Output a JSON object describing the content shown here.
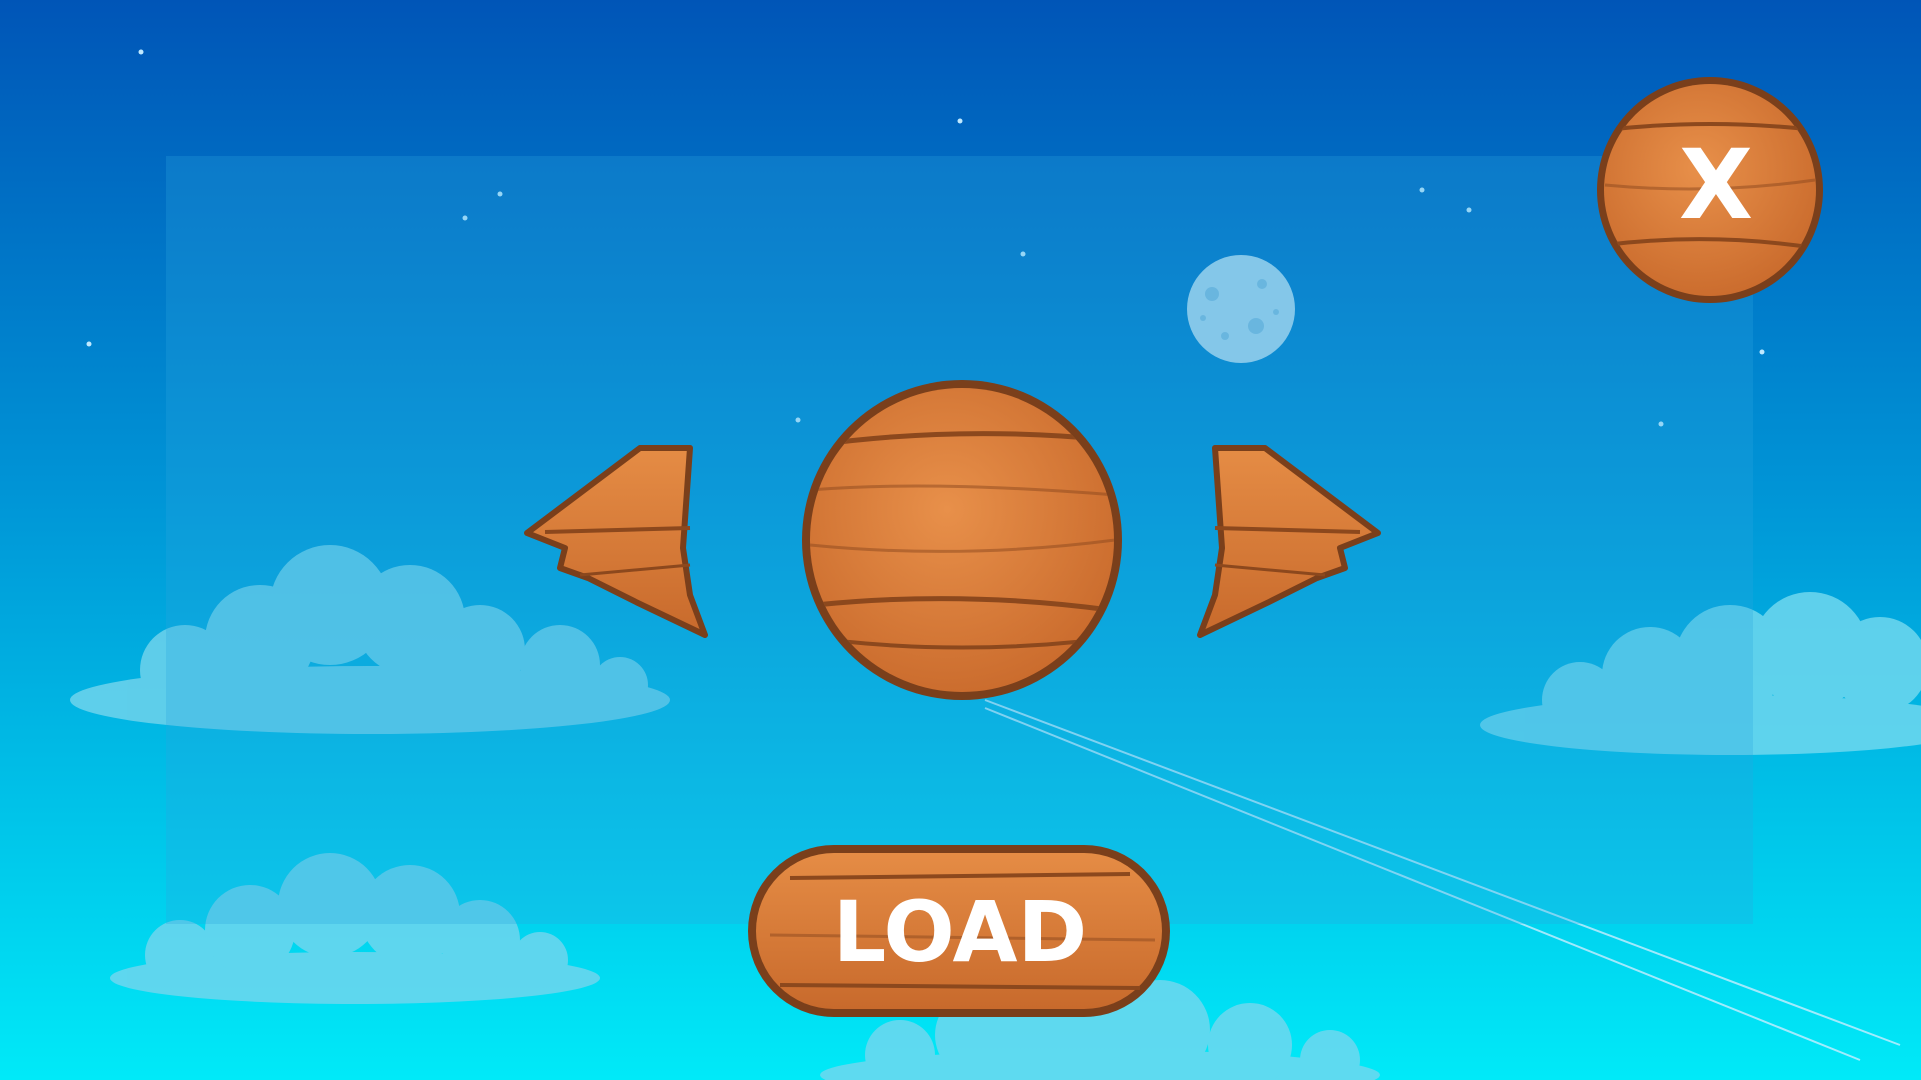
{
  "buttons": {
    "load_label": "LOAD",
    "close_label": "X"
  },
  "colors": {
    "sky_top": "#0057b8",
    "sky_bottom": "#00eaf7",
    "wood_light": "#e0843e",
    "wood_dark": "#b85f26",
    "wood_outline": "#7a3f1b",
    "cloud": "#66cfe8",
    "moon": "#a6d3ec"
  },
  "icons": {
    "close": "close-icon",
    "prev": "arrow-left-icon",
    "next": "arrow-right-icon"
  }
}
